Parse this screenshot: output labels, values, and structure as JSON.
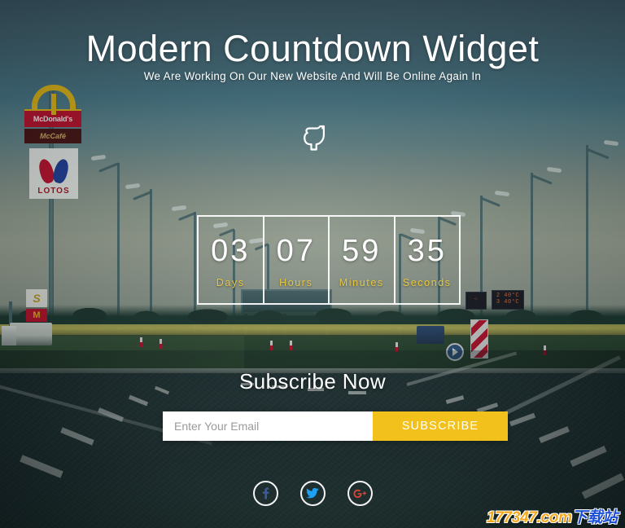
{
  "page": {
    "title": "Modern Countdown Widget",
    "subtitle": "We Are Working On Our New Website And Will Be Online Again In",
    "pointer_icon": "hand-pointer-icon"
  },
  "countdown": {
    "segments": [
      {
        "value": "03",
        "label": "Days"
      },
      {
        "value": "07",
        "label": "Hours"
      },
      {
        "value": "59",
        "label": "Minutes"
      },
      {
        "value": "35",
        "label": "Seconds"
      }
    ]
  },
  "subscribe": {
    "heading": "Subscribe Now",
    "email_placeholder": "Enter Your Email",
    "email_value": "",
    "button_label": "SUBSCRIBE"
  },
  "social": {
    "items": [
      {
        "name": "facebook",
        "glyph": "f",
        "color": "#3b5998"
      },
      {
        "name": "twitter",
        "glyph": "bird",
        "color": "#1da1f2"
      },
      {
        "name": "google-plus",
        "glyph": "G+",
        "color": "#db4437"
      }
    ]
  },
  "watermark": {
    "domain": "177347.com",
    "suffix": "下载站"
  },
  "background": {
    "scene": "highway-at-dusk",
    "billboard": {
      "brand_primary": "McDonald's",
      "brand_secondary": "McCafé",
      "brand_tertiary": "LOTOS"
    },
    "roadside_sign": {
      "fuel": "S",
      "food": "M"
    }
  },
  "colors": {
    "accent_yellow": "#f2c11c",
    "label_gold": "#e8c840",
    "text_white": "#ffffff",
    "watermark_orange": "#f5a81c",
    "watermark_blue": "#1b4fd8"
  }
}
